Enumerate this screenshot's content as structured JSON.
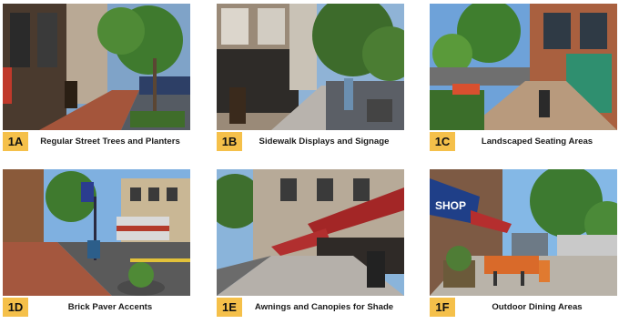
{
  "panels": [
    {
      "id": "1A",
      "caption": "Regular Street Trees and Planters"
    },
    {
      "id": "1B",
      "caption": "Sidewalk Displays and Signage"
    },
    {
      "id": "1C",
      "caption": "Landscaped Seating Areas"
    },
    {
      "id": "1D",
      "caption": "Brick Paver Accents"
    },
    {
      "id": "1E",
      "caption": "Awnings and Canopies for Shade"
    },
    {
      "id": "1F",
      "caption": "Outdoor Dining Areas"
    }
  ],
  "signs": {
    "shop": "SHOP"
  },
  "colors": {
    "badge": "#f5c04a",
    "caption_text": "#1a1a1a"
  }
}
